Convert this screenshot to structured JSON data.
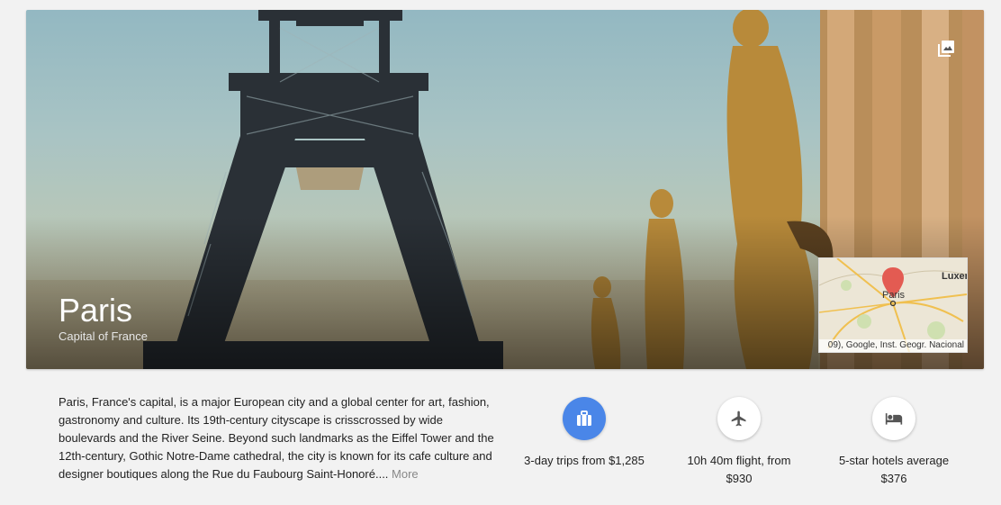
{
  "place": {
    "title": "Paris",
    "subtitle": "Capital of France"
  },
  "map": {
    "label_paris": "Paris",
    "label_luxembourg": "Luxer",
    "attribution": "09), Google, Inst. Geogr. Nacional"
  },
  "description": {
    "text": "Paris, France's capital, is a major European city and a global center for art, fashion, gastronomy and culture. Its 19th-century cityscape is crisscrossed by wide boulevards and the River Seine. Beyond such landmarks as the Eiffel Tower and the 12th-century, Gothic Notre-Dame cathedral, the city is known for its cafe culture and designer boutiques along the Rue du Faubourg Saint-Honoré.",
    "ellipsis": "...",
    "more_label": "More"
  },
  "stats": [
    {
      "icon": "briefcase-icon",
      "label": "3-day trips from $1,285"
    },
    {
      "icon": "airplane-icon",
      "label": "10h 40m flight, from $930"
    },
    {
      "icon": "hotel-bed-icon",
      "label": "5-star hotels average $376"
    }
  ],
  "colors": {
    "accent": "#4a86e8",
    "map_pin": "#e35b52"
  }
}
